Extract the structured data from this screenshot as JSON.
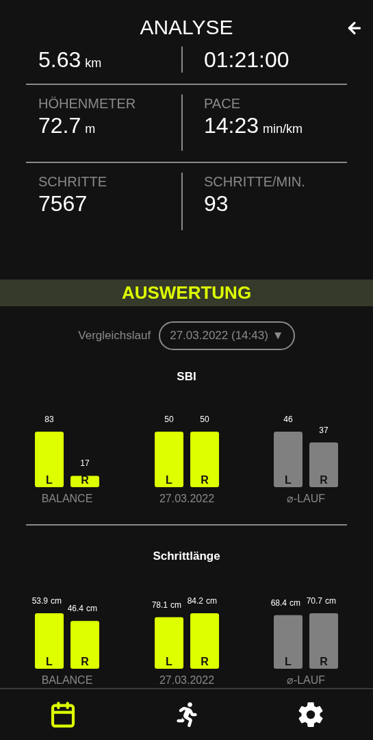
{
  "header": {
    "title": "ANALYSE"
  },
  "stats": [
    {
      "value": "5.63",
      "unit": "km"
    },
    {
      "value": "01:21:00"
    },
    {
      "label": "HÖHENMETER",
      "value": "72.7",
      "unit": "m"
    },
    {
      "label": "PACE",
      "value": "14:23",
      "unit": "min/km"
    },
    {
      "label": "SCHRITTE",
      "value": "7567"
    },
    {
      "label": "SCHRITTE/MIN.",
      "value": "93"
    }
  ],
  "banner": {
    "title": "AUSWERTUNG"
  },
  "comparison": {
    "label": "Vergleichslauf",
    "value": "27.03.2022 (14:43)",
    "caret": "▼"
  },
  "sections": [
    {
      "title": "SBI",
      "charts": [
        {
          "chart_data": {
            "type": "bar",
            "xlabel": "BALANCE",
            "categories": [
              "L",
              "R"
            ],
            "series": [
              {
                "color": "#ddff00",
                "values": [
                  83,
                  17
                ]
              }
            ],
            "data_labels": true
          }
        },
        {
          "chart_data": {
            "type": "bar",
            "xlabel": "27.03.2022",
            "categories": [
              "L",
              "R"
            ],
            "series": [
              {
                "color": "#ddff00",
                "values": [
                  50,
                  50
                ]
              }
            ],
            "data_labels": true
          }
        },
        {
          "chart_data": {
            "type": "bar",
            "xlabel": "⌀-LAUF",
            "categories": [
              "L",
              "R"
            ],
            "series": [
              {
                "color": "#808080",
                "values": [
                  46,
                  37
                ]
              }
            ],
            "data_labels": true
          }
        }
      ]
    },
    {
      "title": "Schrittlänge",
      "charts": [
        {
          "units": [
            "cm",
            "cm"
          ],
          "chart_data": {
            "type": "bar",
            "xlabel": "BALANCE",
            "categories": [
              "L",
              "R"
            ],
            "series": [
              {
                "color": "#ddff00",
                "values": [
                  53.9,
                  46.4
                ]
              }
            ],
            "data_labels": true
          }
        },
        {
          "units": [
            "cm",
            "cm"
          ],
          "chart_data": {
            "type": "bar",
            "xlabel": "27.03.2022",
            "categories": [
              "L",
              "R"
            ],
            "series": [
              {
                "color": "#ddff00",
                "values": [
                  78.1,
                  84.2
                ]
              }
            ],
            "data_labels": true
          }
        },
        {
          "units": [
            "cm",
            "cm"
          ],
          "chart_data": {
            "type": "bar",
            "xlabel": "⌀-LAUF",
            "categories": [
              "L",
              "R"
            ],
            "series": [
              {
                "color": "#808080",
                "values": [
                  68.4,
                  70.7
                ]
              }
            ],
            "data_labels": true
          }
        }
      ]
    }
  ],
  "nav": [
    {
      "kind": "calendar",
      "selected": true
    },
    {
      "kind": "running",
      "selected": false
    },
    {
      "kind": "settings",
      "selected": false
    }
  ]
}
